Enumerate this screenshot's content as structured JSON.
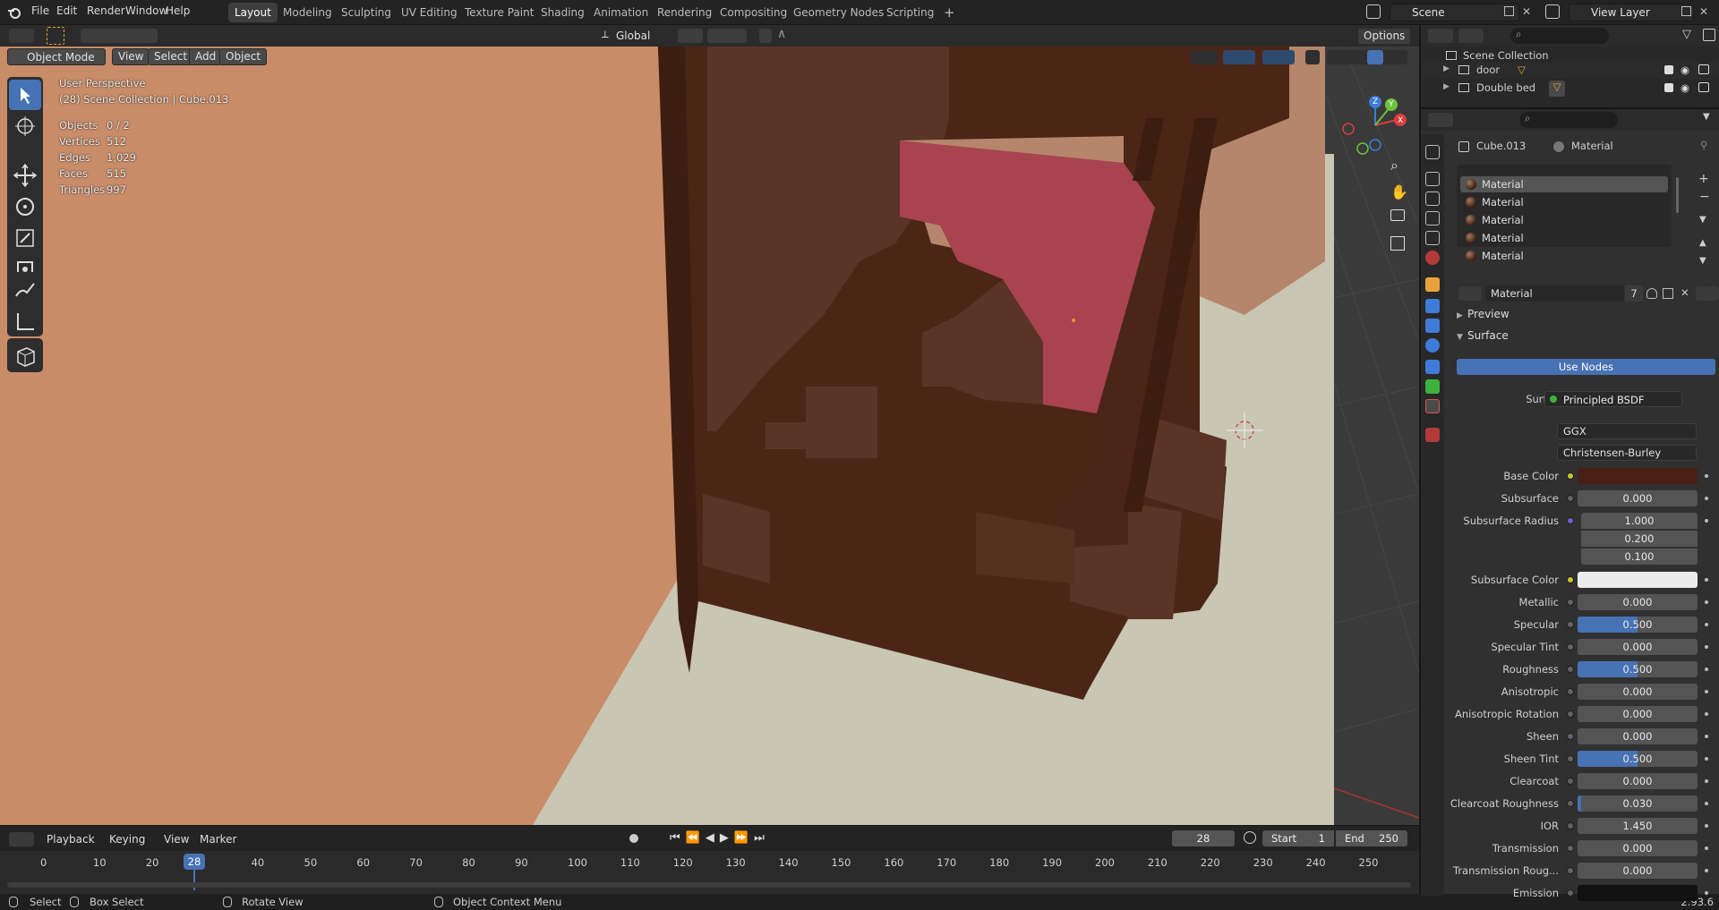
{
  "topbar": {
    "menus": [
      "File",
      "Edit",
      "Render",
      "Window",
      "Help"
    ],
    "workspaces": [
      "Layout",
      "Modeling",
      "Sculpting",
      "UV Editing",
      "Texture Paint",
      "Shading",
      "Animation",
      "Rendering",
      "Compositing",
      "Geometry Nodes",
      "Scripting"
    ],
    "active_workspace": "Layout",
    "add_workspace": "+",
    "scene": "Scene",
    "view_layer": "View Layer"
  },
  "viewport_header": {
    "mode": "Object Mode",
    "menus": [
      "View",
      "Select",
      "Add",
      "Object"
    ],
    "orientation": "Global",
    "options": "Options"
  },
  "overlay": {
    "perspective": "User Perspective",
    "collection": "(28) Scene Collection | Cube.013",
    "stats": [
      {
        "label": "Objects",
        "value": "0 / 2"
      },
      {
        "label": "Vertices",
        "value": "512"
      },
      {
        "label": "Edges",
        "value": "1,029"
      },
      {
        "label": "Faces",
        "value": "515"
      },
      {
        "label": "Triangles",
        "value": "997"
      }
    ],
    "gizmo_axes": {
      "z": "Z",
      "y": "Y",
      "x": "X"
    }
  },
  "timeline": {
    "menus": [
      "Playback",
      "Keying",
      "View",
      "Marker"
    ],
    "current_frame": "28",
    "start_label": "Start",
    "start": "1",
    "end_label": "End",
    "end": "250",
    "ruler": [
      "0",
      "10",
      "20",
      "40",
      "50",
      "60",
      "70",
      "80",
      "90",
      "100",
      "110",
      "120",
      "130",
      "140",
      "150",
      "160",
      "170",
      "180",
      "190",
      "200",
      "210",
      "220",
      "230",
      "240",
      "250"
    ]
  },
  "statusbar": {
    "select": "Select",
    "box_select": "Box Select",
    "rotate": "Rotate View",
    "context_menu": "Object Context Menu",
    "version": "2.93.6"
  },
  "outliner": {
    "root": "Scene Collection",
    "items": [
      {
        "name": "door"
      },
      {
        "name": "Double bed"
      }
    ]
  },
  "properties": {
    "object_name": "Cube.013",
    "material_tab": "Material",
    "slots": [
      "Material",
      "Material",
      "Material",
      "Material",
      "Material"
    ],
    "material_name": "Material",
    "users": "7",
    "preview": "Preview",
    "surface_panel": "Surface",
    "use_nodes": "Use Nodes",
    "surface_label": "Surface",
    "surface_value": "Principled BSDF",
    "distribution": "GGX",
    "subsurface_method": "Christensen-Burley",
    "base_color_label": "Base Color",
    "base_color": "#4a1f14",
    "subsurface_color_label": "Subsurface Color",
    "subsurface_color": "#ececec",
    "subsurface_radius_label": "Subsurface Radius",
    "subsurface_radius": [
      "1.000",
      "0.200",
      "0.100"
    ],
    "fields": [
      {
        "label": "Subsurface",
        "value": "0.000",
        "fill": 0
      },
      {
        "label": "Metallic",
        "value": "0.000",
        "fill": 0
      },
      {
        "label": "Specular",
        "value": "0.500",
        "fill": 0.5
      },
      {
        "label": "Specular Tint",
        "value": "0.000",
        "fill": 0
      },
      {
        "label": "Roughness",
        "value": "0.500",
        "fill": 0.5
      },
      {
        "label": "Anisotropic",
        "value": "0.000",
        "fill": 0
      },
      {
        "label": "Anisotropic Rotation",
        "value": "0.000",
        "fill": 0
      },
      {
        "label": "Sheen",
        "value": "0.000",
        "fill": 0
      },
      {
        "label": "Sheen Tint",
        "value": "0.500",
        "fill": 0.5
      },
      {
        "label": "Clearcoat",
        "value": "0.000",
        "fill": 0
      },
      {
        "label": "Clearcoat Roughness",
        "value": "0.030",
        "fill": 0.03
      },
      {
        "label": "IOR",
        "value": "1.450",
        "fill": 0
      },
      {
        "label": "Transmission",
        "value": "0.000",
        "fill": 0
      },
      {
        "label": "Transmission Roug...",
        "value": "0.000",
        "fill": 0
      },
      {
        "label": "Emission",
        "value": "",
        "fill": 0
      }
    ]
  }
}
